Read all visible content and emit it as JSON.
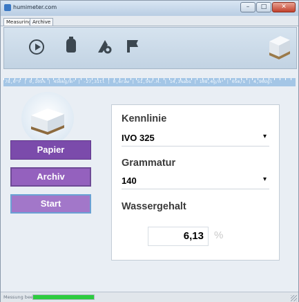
{
  "window": {
    "title": "humimeter.com"
  },
  "tabs": [
    {
      "label": "Measuring",
      "active": true
    },
    {
      "label": "Archive",
      "active": false
    }
  ],
  "toolbar": {
    "icons": [
      "play-icon",
      "device-icon",
      "settings-icon",
      "flag-icon",
      "paper-stack-icon"
    ]
  },
  "ruler": {
    "text": "78,0°F | 0,105% | 456kg/m³ | -27,31tl | 0,6raw | 51,5%r.H. | 14,3%abs | 108,4g/m² | 05m/s | 4,90Ugl"
  },
  "sidebar": {
    "buttons": [
      {
        "label": "Papier"
      },
      {
        "label": "Archiv"
      },
      {
        "label": "Start"
      }
    ]
  },
  "form": {
    "kennlinie_label": "Kennlinie",
    "kennlinie_value": "IVO 325",
    "grammatur_label": "Grammatur",
    "grammatur_value": "140",
    "wassergehalt_label": "Wassergehalt",
    "wassergehalt_value": "6,13",
    "unit": "%"
  },
  "status": {
    "text": "Messung beendet",
    "progress": 1.0
  },
  "colors": {
    "accent_purple": "#7b4bab",
    "progress_green": "#2ecc40",
    "ruler_blue": "#a4c6e6"
  }
}
